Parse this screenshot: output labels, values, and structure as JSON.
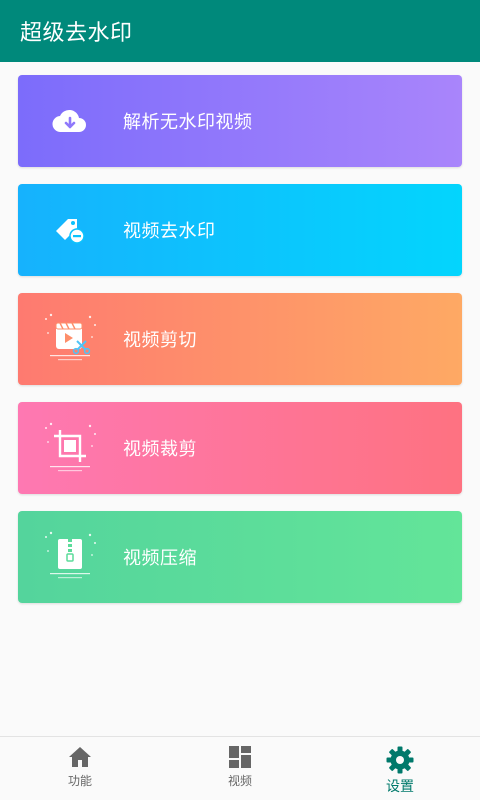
{
  "appbar": {
    "title": "超级去水印"
  },
  "features": [
    {
      "label": "解析无水印视频",
      "icon": "cloud-download-icon"
    },
    {
      "label": "视频去水印",
      "icon": "tag-remove-icon"
    },
    {
      "label": "视频剪切",
      "icon": "video-scissors-icon"
    },
    {
      "label": "视频裁剪",
      "icon": "crop-icon"
    },
    {
      "label": "视频压缩",
      "icon": "zip-compress-icon"
    }
  ],
  "bottom_nav": {
    "active": "设置",
    "tabs": [
      {
        "label": "功能",
        "icon": "home-icon"
      },
      {
        "label": "视频",
        "icon": "dashboard-grid-icon"
      },
      {
        "label": "设置",
        "icon": "gear-icon"
      }
    ]
  },
  "colors": {
    "appbar": "#00897b",
    "active_tab": "#00796b",
    "inactive_tab": "#666666"
  }
}
